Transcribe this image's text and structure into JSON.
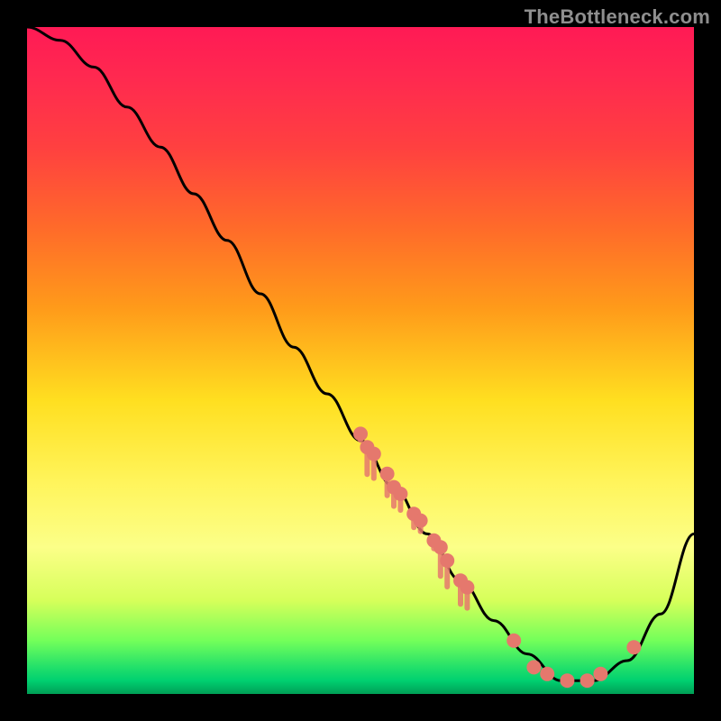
{
  "watermark": "TheBottleneck.com",
  "colors": {
    "background": "#000000",
    "curve": "#000000",
    "marker": "#e5786d"
  },
  "chart_data": {
    "type": "line",
    "title": "",
    "xlabel": "",
    "ylabel": "",
    "xlim": [
      0,
      100
    ],
    "ylim": [
      0,
      100
    ],
    "legend": false,
    "grid": false,
    "note": "Values are approximate — read off the unlabeled plot. X runs left→right 0–100, Y runs bottom→top 0–100. The curve falls from near top-left to a minimum near x≈80 then rises toward the right edge. Marker clusters sit on the curve.",
    "series": [
      {
        "name": "bottleneck-curve",
        "x": [
          0,
          5,
          10,
          15,
          20,
          25,
          30,
          35,
          40,
          45,
          50,
          55,
          60,
          65,
          70,
          75,
          80,
          85,
          90,
          95,
          100
        ],
        "y": [
          100,
          98,
          94,
          88,
          82,
          75,
          68,
          60,
          52,
          45,
          38,
          31,
          24,
          17,
          11,
          6,
          2,
          2,
          5,
          12,
          24
        ]
      }
    ],
    "markers": [
      {
        "x": 50,
        "y": 39
      },
      {
        "x": 51,
        "y": 37
      },
      {
        "x": 52,
        "y": 36
      },
      {
        "x": 54,
        "y": 33
      },
      {
        "x": 55,
        "y": 31
      },
      {
        "x": 56,
        "y": 30
      },
      {
        "x": 58,
        "y": 27
      },
      {
        "x": 59,
        "y": 26
      },
      {
        "x": 61,
        "y": 23
      },
      {
        "x": 62,
        "y": 22
      },
      {
        "x": 63,
        "y": 20
      },
      {
        "x": 65,
        "y": 17
      },
      {
        "x": 66,
        "y": 16
      },
      {
        "x": 73,
        "y": 8
      },
      {
        "x": 76,
        "y": 4
      },
      {
        "x": 78,
        "y": 3
      },
      {
        "x": 81,
        "y": 2
      },
      {
        "x": 84,
        "y": 2
      },
      {
        "x": 86,
        "y": 3
      },
      {
        "x": 91,
        "y": 7
      }
    ]
  }
}
